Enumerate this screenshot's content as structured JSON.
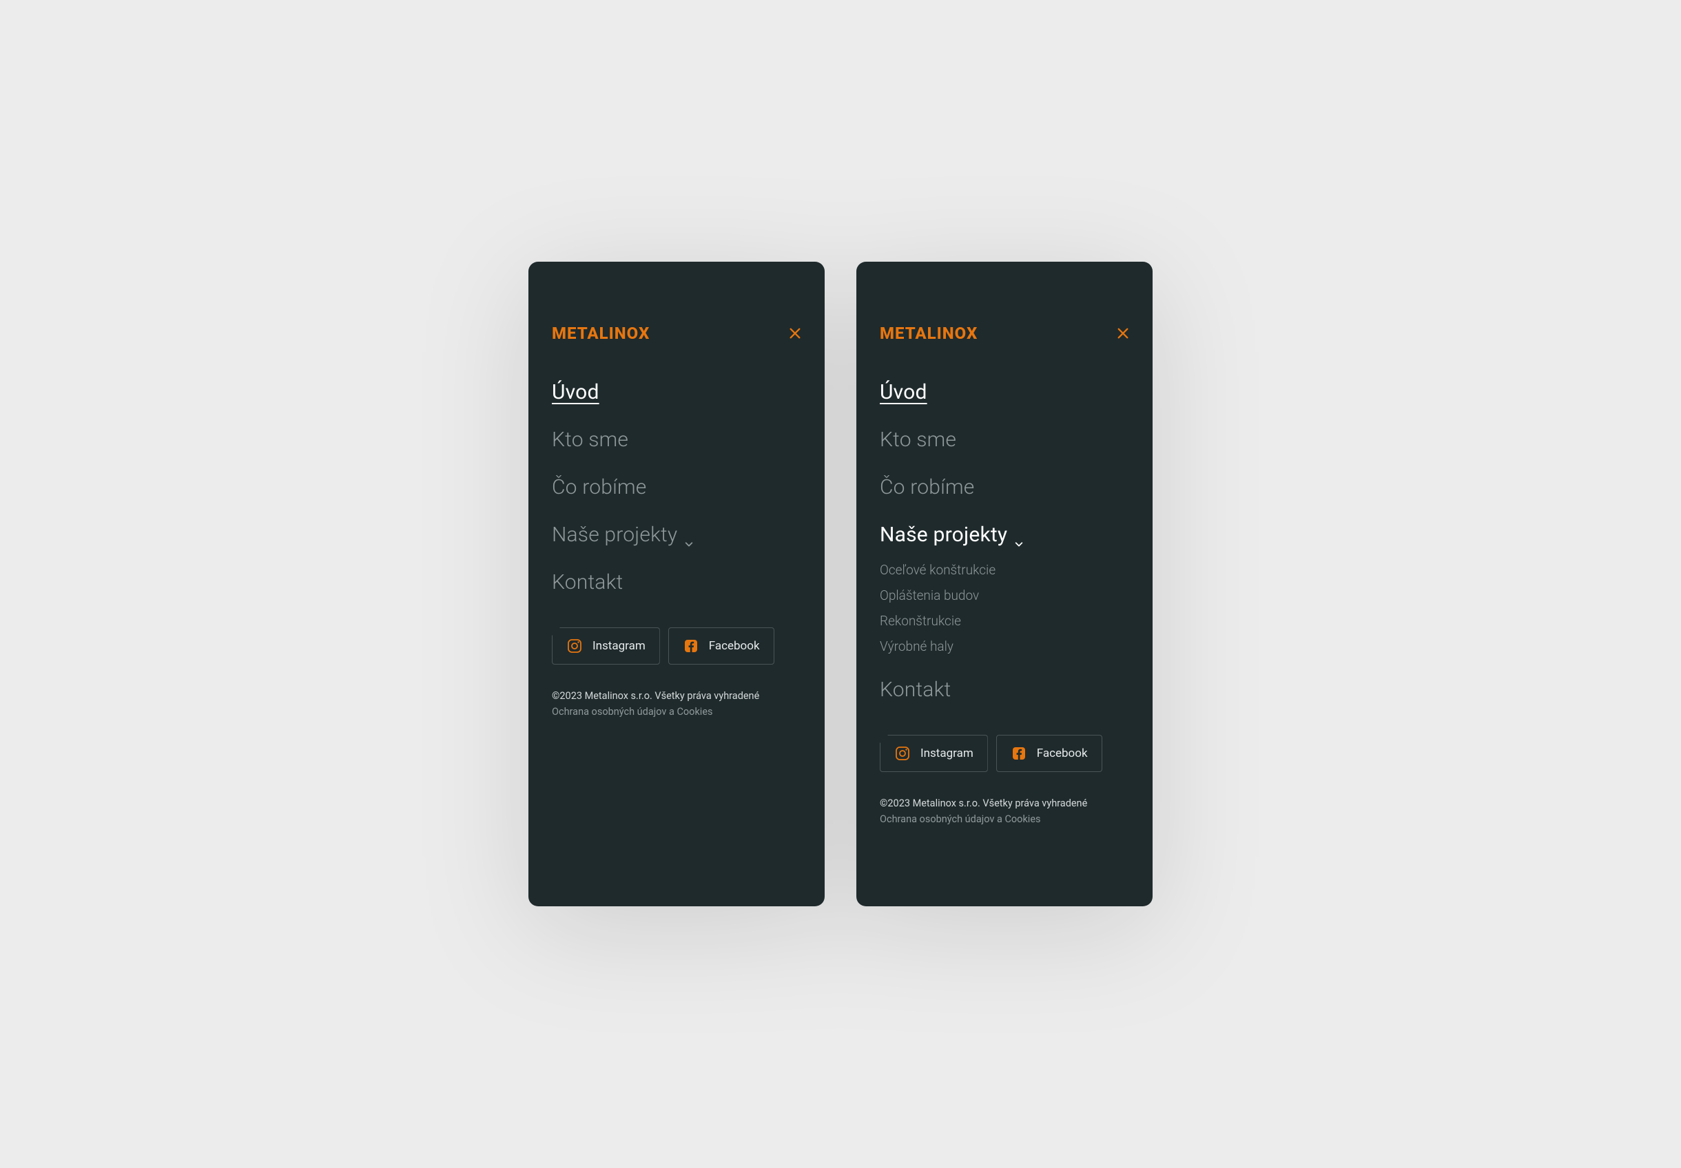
{
  "brand": "METALINOX",
  "colors": {
    "accent": "#e7760f",
    "panel": "#1f2a2c"
  },
  "nav": {
    "items": [
      {
        "label": "Úvod"
      },
      {
        "label": "Kto sme"
      },
      {
        "label": "Čo robíme"
      },
      {
        "label": "Naše projekty"
      },
      {
        "label": "Kontakt"
      }
    ],
    "sub": [
      {
        "label": "Oceľové konštrukcie"
      },
      {
        "label": "Opláštenia budov"
      },
      {
        "label": "Rekonštrukcie"
      },
      {
        "label": "Výrobné haly"
      }
    ]
  },
  "social": {
    "instagram": "Instagram",
    "facebook": "Facebook"
  },
  "legal": {
    "copyright": "©2023 Metalinox s.r.o. Všetky práva vyhradené",
    "privacy": "Ochrana osobných údajov a Cookies"
  }
}
